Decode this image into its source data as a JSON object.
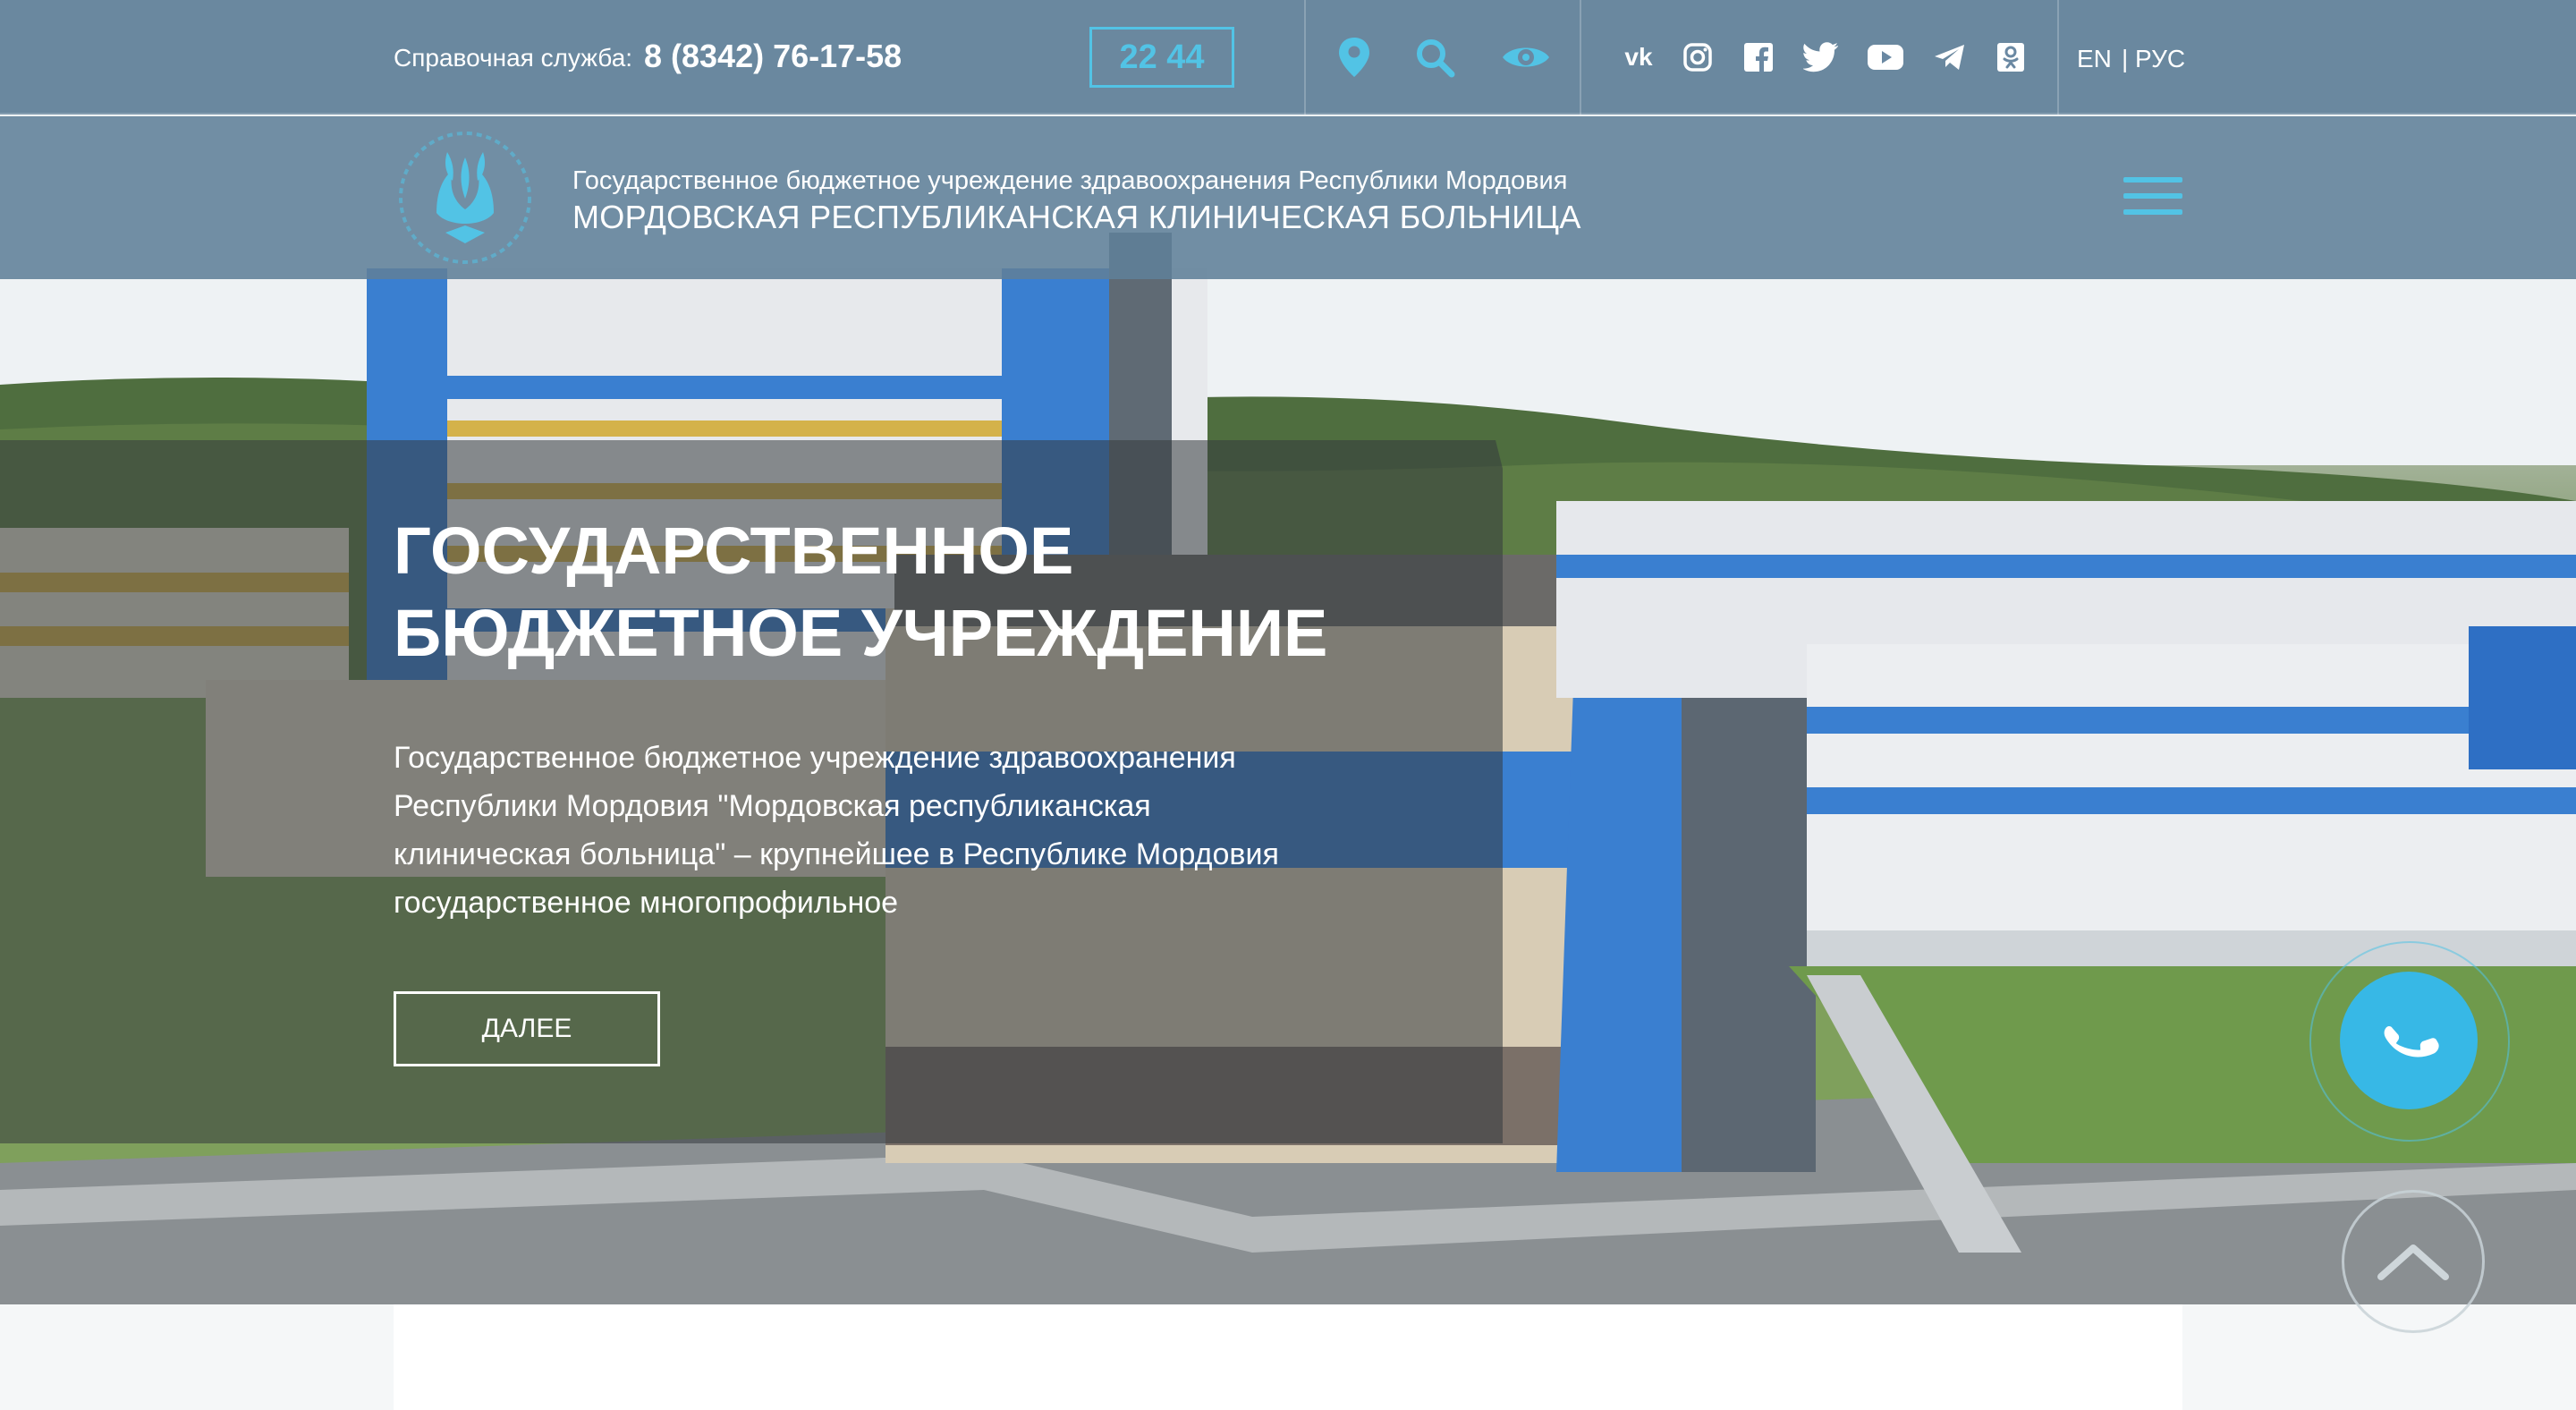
{
  "topbar": {
    "hotline_label": "Справочная служба:",
    "hotline_phone": "8 (8342) 76-17-58",
    "time": "22 44",
    "icons": [
      "location-pin-icon",
      "search-icon",
      "eye-icon"
    ],
    "social": [
      "vk-icon",
      "instagram-icon",
      "facebook-icon",
      "twitter-icon",
      "youtube-icon",
      "telegram-icon",
      "odnoklassniki-icon"
    ],
    "lang_en": "EN",
    "lang_ru": "| РУС"
  },
  "header": {
    "org_subtitle": "Государственное бюджетное учреждение здравоохранения Республики Мордовия",
    "org_name": "МОРДОВСКАЯ РЕСПУБЛИКАНСКАЯ КЛИНИЧЕСКАЯ БОЛЬНИЦА"
  },
  "hero": {
    "title_line1": "ГОСУДАРСТВЕННОЕ",
    "title_line2": "БЮДЖЕТНОЕ УЧРЕЖДЕНИЕ",
    "text": "Государственное бюджетное учреждение здравоохранения Республики Мордовия \"Мордовская республиканская клиническая больница\" – крупнейшее в Республике Мордовия государственное многопрофильное",
    "button": "ДАЛЕЕ"
  },
  "colors": {
    "accent": "#52c3e5",
    "bar": "#6080a0",
    "call": "#37b8e6"
  }
}
